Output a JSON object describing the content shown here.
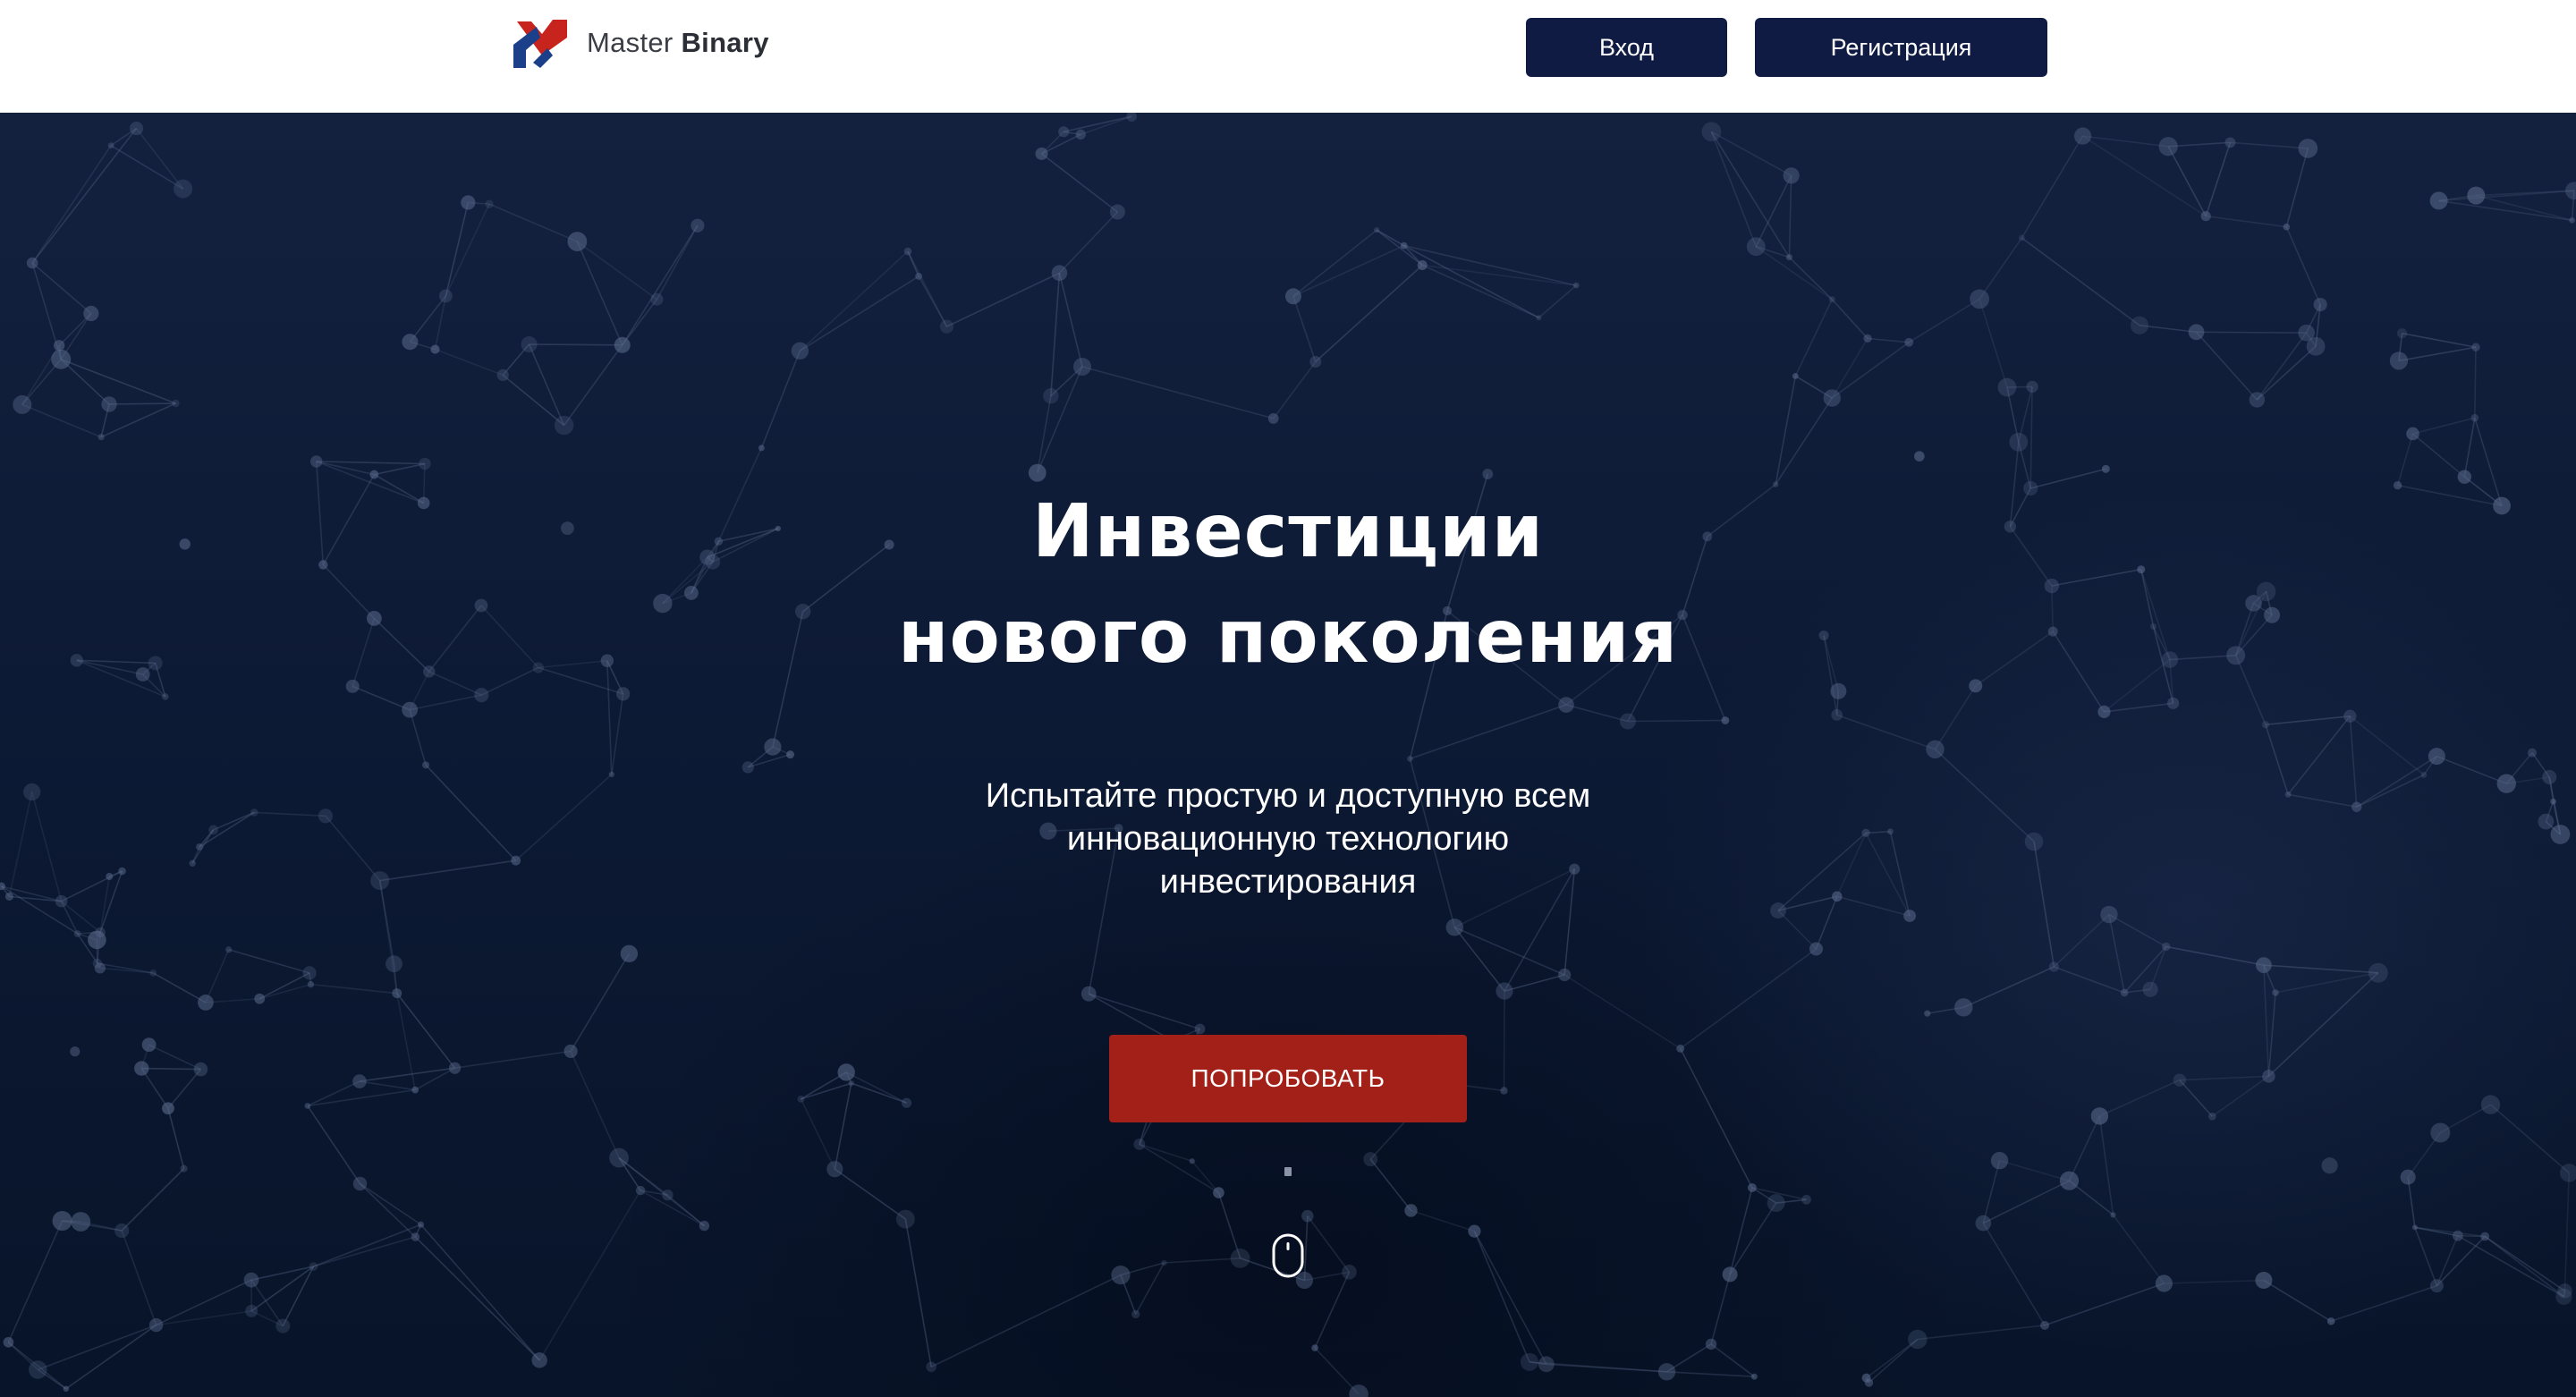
{
  "header": {
    "logo": {
      "text_light": "Master",
      "text_bold": "Binary",
      "icon": "master-binary-logo-icon",
      "colors": {
        "red": "#c8241e",
        "blue": "#1c3f8a"
      }
    },
    "login_label": "Вход",
    "register_label": "Регистрация"
  },
  "hero": {
    "title_line1": "Инвестиции",
    "title_line2": "нового поколения",
    "subtitle_line1": "Испытайте простую и доступную всем",
    "subtitle_line2": "инновационную технологию",
    "subtitle_line3": "инвестирования",
    "cta_label": "ПОПРОБОВАТЬ",
    "scroll_icon": "mouse-scroll-icon"
  },
  "colors": {
    "nav_button": "#0f1b42",
    "cta": "#a32018",
    "hero_background": "#0d1a35",
    "network_lines": "#5b6b8c"
  }
}
